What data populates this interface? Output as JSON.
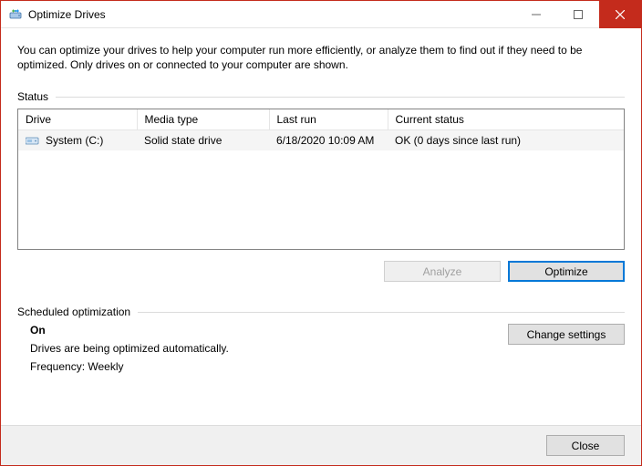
{
  "window": {
    "title": "Optimize Drives"
  },
  "intro": "You can optimize your drives to help your computer run more efficiently, or analyze them to find out if they need to be optimized. Only drives on or connected to your computer are shown.",
  "status": {
    "label": "Status",
    "columns": {
      "drive": "Drive",
      "media": "Media type",
      "lastrun": "Last run",
      "status": "Current status"
    },
    "rows": [
      {
        "drive": "System (C:)",
        "media": "Solid state drive",
        "lastrun": "6/18/2020 10:09 AM",
        "status": "OK (0 days since last run)"
      }
    ]
  },
  "buttons": {
    "analyze": "Analyze",
    "optimize": "Optimize",
    "change_settings": "Change settings",
    "close": "Close"
  },
  "scheduled": {
    "label": "Scheduled optimization",
    "state": "On",
    "desc": "Drives are being optimized automatically.",
    "frequency_label": "Frequency:",
    "frequency_value": "Weekly"
  }
}
